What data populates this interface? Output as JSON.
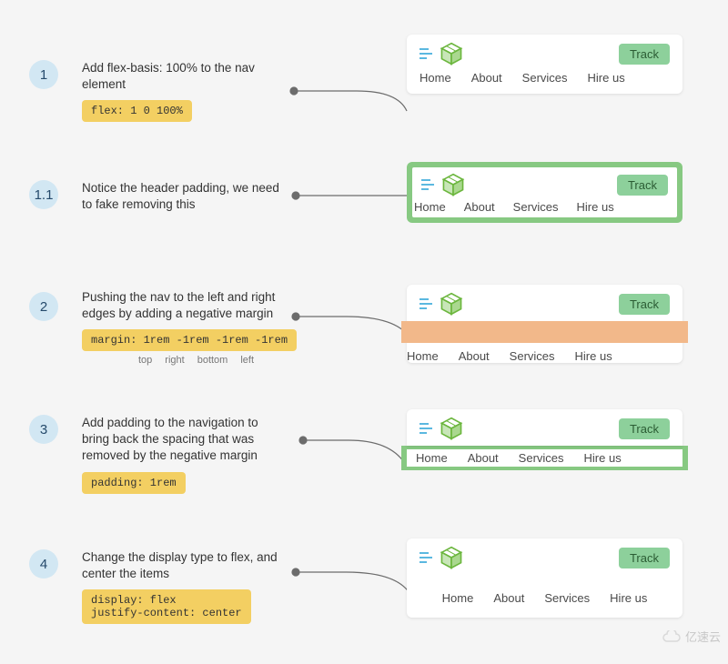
{
  "steps": {
    "s1": {
      "num": "1",
      "desc": "Add flex-basis: 100% to the nav element",
      "code": "flex: 1 0 100%"
    },
    "s1_1": {
      "num": "1.1",
      "desc": "Notice the header padding, we need to fake removing this"
    },
    "s2": {
      "num": "2",
      "desc": "Pushing the nav to the left and right edges by adding a negative margin",
      "code": "margin: 1rem -1rem -1rem -1rem",
      "labels": {
        "a": "top",
        "b": "right",
        "c": "bottom",
        "d": "left"
      }
    },
    "s3": {
      "num": "3",
      "desc": "Add padding to the navigation to bring back the spacing that was removed by the negative margin",
      "code": "padding: 1rem"
    },
    "s4": {
      "num": "4",
      "desc": "Change the display type to flex, and center the items",
      "code": "display: flex\njustify-content: center"
    }
  },
  "nav": {
    "track": "Track",
    "items": {
      "home": "Home",
      "about": "About",
      "services": "Services",
      "hire": "Hire us"
    }
  },
  "watermark": "亿速云"
}
